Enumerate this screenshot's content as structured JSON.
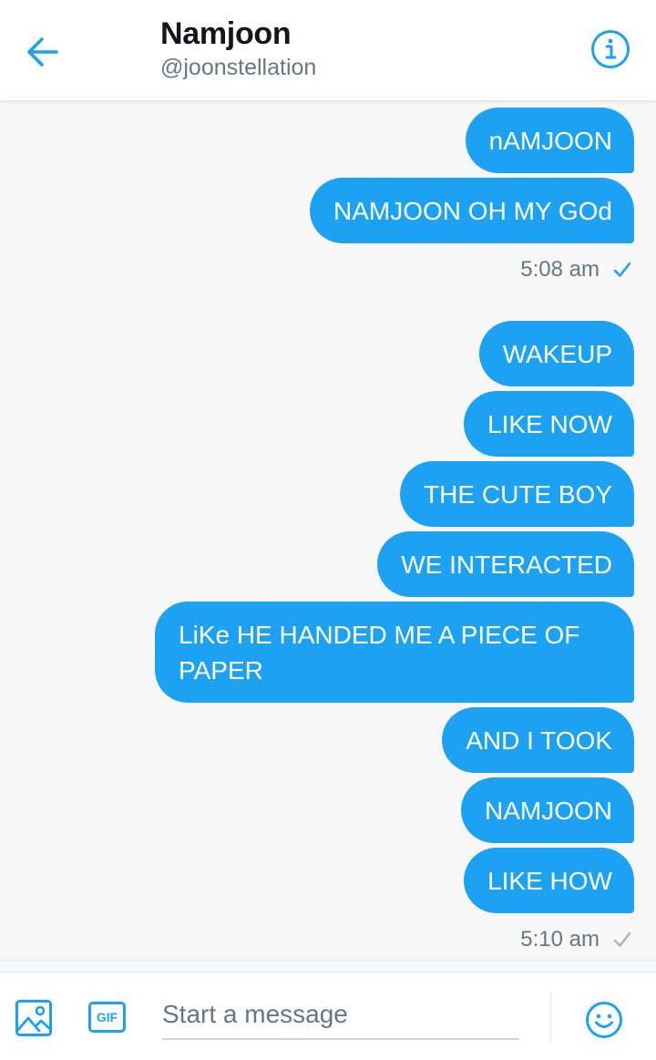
{
  "header": {
    "back_icon": "arrow-left-icon",
    "title": "Namjoon",
    "handle": "@joonstellation",
    "info_icon": "info-icon"
  },
  "messages": [
    {
      "text": "nAMJOON",
      "direction": "sent"
    },
    {
      "text": "NAMJOON OH MY GOd",
      "direction": "sent"
    },
    {
      "text": "WAKEUP",
      "direction": "sent"
    },
    {
      "text": "LIKE NOW",
      "direction": "sent"
    },
    {
      "text": "THE CUTE BOY",
      "direction": "sent"
    },
    {
      "text": "WE INTERACTED",
      "direction": "sent"
    },
    {
      "text": "LiKe HE HANDED ME A PIECE OF PAPER",
      "direction": "sent"
    },
    {
      "text": "AND I TOOK",
      "direction": "sent"
    },
    {
      "text": "NAMJOON",
      "direction": "sent"
    },
    {
      "text": "LIKE HOW",
      "direction": "sent"
    }
  ],
  "timestamps": [
    {
      "text": "5:08 am",
      "status": "read",
      "check_color": "#1da1f2"
    },
    {
      "text": "5:10 am",
      "status": "sent",
      "check_color": "#aab8c2"
    }
  ],
  "composer": {
    "media_icon": "image-icon",
    "gif_label": "GIF",
    "placeholder": "Start a message",
    "value": "",
    "emoji_icon": "emoji-icon"
  },
  "colors": {
    "accent": "#1da1f2",
    "text_primary": "#14171a",
    "text_secondary": "#657786"
  }
}
